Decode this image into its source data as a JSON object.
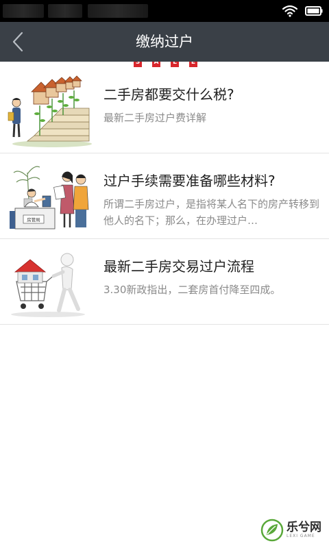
{
  "app_bar": {
    "title": "缴纳过户",
    "back_icon": "chevron-left-icon"
  },
  "status_bar": {
    "icons": [
      "wifi-icon",
      "battery-icon"
    ]
  },
  "banner_fragment": {
    "letters": [
      "S",
      "A",
      "L",
      "E"
    ],
    "color": "#d8262c"
  },
  "articles": [
    {
      "title": "二手房都要交什么税?",
      "description": "最新二手房过户费详解",
      "thumbnail": "house-stairs-illustration"
    },
    {
      "title": "过户手续需要准备哪些材料?",
      "description": "所谓二手房过户，是指将某人名下的房产转移到他人的名下；那么，在办理过户…",
      "thumbnail": "housing-bureau-office-illustration",
      "thumbnail_label": "房管局"
    },
    {
      "title": "最新二手房交易过户流程",
      "description": "3.30新政指出，二套房首付降至四成。",
      "thumbnail": "person-pushing-cart-house-illustration"
    }
  ],
  "watermark": {
    "name": "乐兮网",
    "sub": "LEXI GAME"
  },
  "colors": {
    "app_bar": "#3a4047",
    "title_text": "#1f1f1f",
    "desc_text": "#8a8a8a",
    "divider": "#e3e3e3"
  }
}
